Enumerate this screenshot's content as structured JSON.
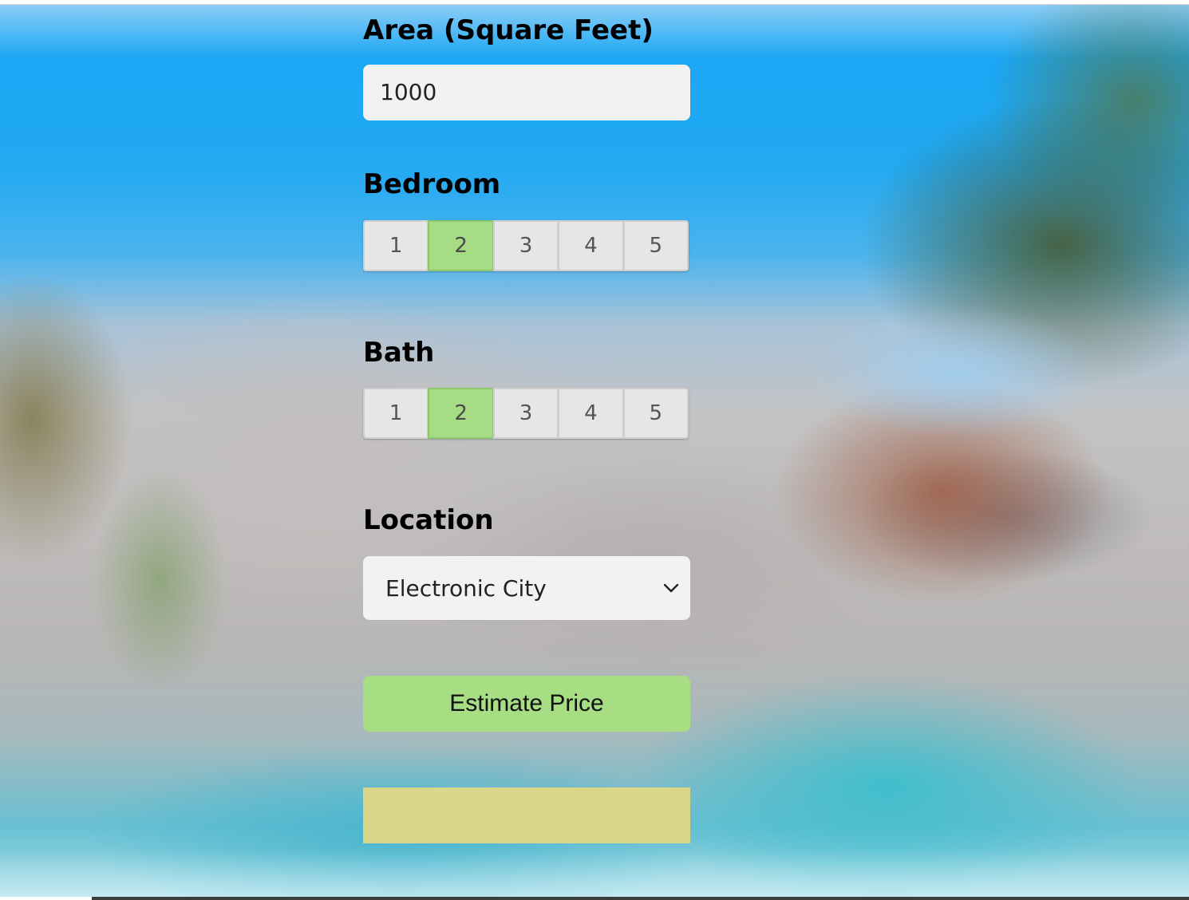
{
  "form": {
    "area": {
      "label": "Area (Square Feet)",
      "value": "1000"
    },
    "bedroom": {
      "label": "Bedroom",
      "options": [
        "1",
        "2",
        "3",
        "4",
        "5"
      ],
      "selected": "2"
    },
    "bath": {
      "label": "Bath",
      "options": [
        "1",
        "2",
        "3",
        "4",
        "5"
      ],
      "selected": "2"
    },
    "location": {
      "label": "Location",
      "selected": "Electronic City"
    },
    "estimate_button": "Estimate Price",
    "result_text": ""
  },
  "colors": {
    "accent_green": "#a7de84",
    "result_yellow": "#dcd68a",
    "input_bg": "#f2f2f2"
  },
  "icons": {
    "select_arrow": "chevron-down-icon"
  }
}
